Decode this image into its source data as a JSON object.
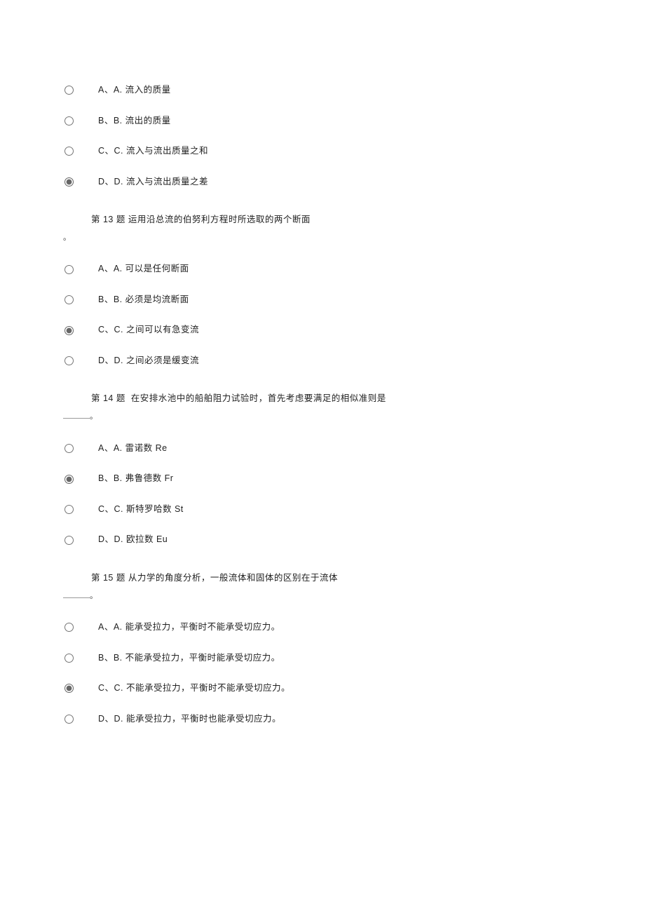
{
  "q12": {
    "choices": [
      {
        "label": "A、A.  流入的质量"
      },
      {
        "label": "B、B.  流出的质量"
      },
      {
        "label": "C、C. 流入与流出质量之和"
      },
      {
        "label": "D、D. 流入与流出质量之差"
      }
    ],
    "selected": 3
  },
  "q13": {
    "prompt": "第 13 题 运用沿总流的伯努利方程时所选取的两个断面",
    "trail": "。",
    "choices": [
      {
        "label": "A、A.  可以是任何断面"
      },
      {
        "label": "B、B.  必须是均流断面"
      },
      {
        "label": "C、C.  之间可以有急变流"
      },
      {
        "label": "D、D.  之间必须是缓变流"
      }
    ],
    "selected": 2
  },
  "q14": {
    "prompt": "第 14 题  安排水池中的船舶阻力试验时，首先考虑要满足的相似准则是",
    "prompt_prefix": "在",
    "trail_suffix": "。",
    "choices": [
      {
        "label": "A、A. 雷诺数 Re"
      },
      {
        "label": "B、B.  弗鲁德数 Fr"
      },
      {
        "label": "C、C. 斯特罗哈数 St"
      },
      {
        "label": "D、D. 欧拉数 Eu"
      }
    ],
    "selected": 1
  },
  "q15": {
    "prompt": "第 15 题  从力学的角度分析，一般流体和固体的区别在于流体",
    "trail_suffix": "。",
    "choices": [
      {
        "label": "A、A. 能承受拉力，平衡时不能承受切应力。"
      },
      {
        "label": "B、B. 不能承受拉力，平衡时能承受切应力。"
      },
      {
        "label": "C、C. 不能承受拉力，平衡时不能承受切应力。"
      },
      {
        "label": "D、D. 能承受拉力，平衡时也能承受切应力。"
      }
    ],
    "selected": 2
  }
}
